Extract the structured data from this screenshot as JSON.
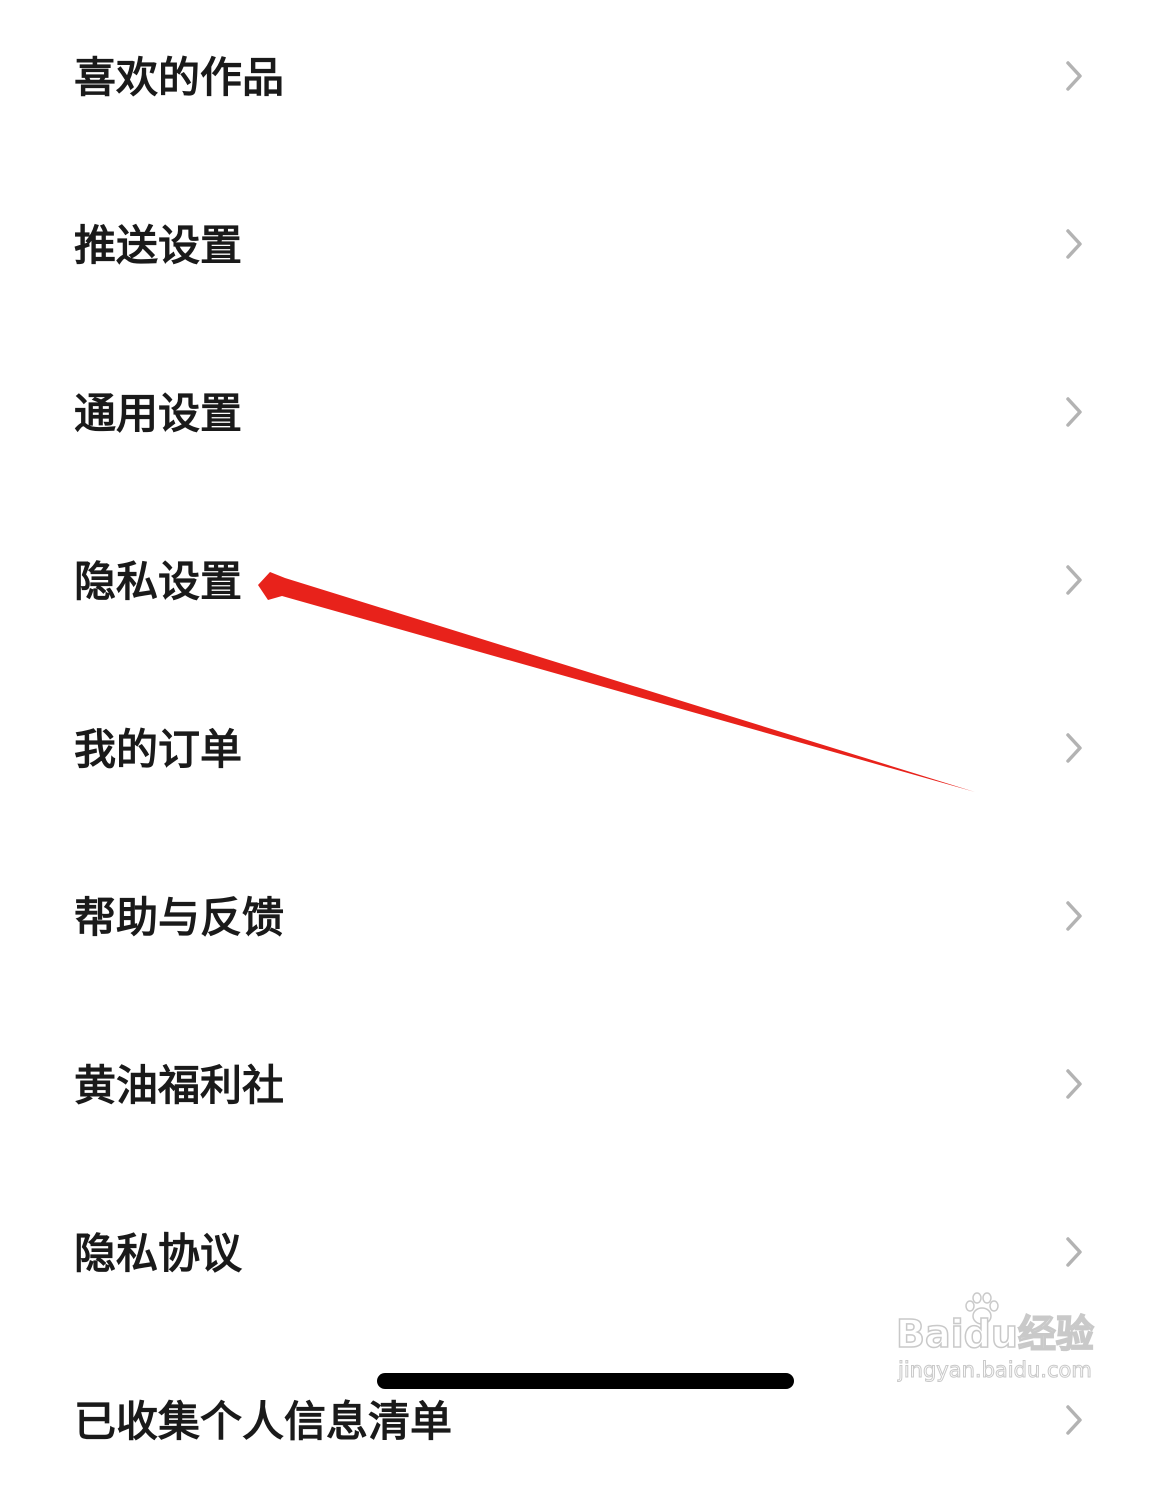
{
  "settings": {
    "items": [
      {
        "label": "喜欢的作品",
        "icon": "chevron-right-icon"
      },
      {
        "label": "推送设置",
        "icon": "chevron-right-icon"
      },
      {
        "label": "通用设置",
        "icon": "chevron-right-icon"
      },
      {
        "label": "隐私设置",
        "icon": "chevron-right-icon"
      },
      {
        "label": "我的订单",
        "icon": "chevron-right-icon"
      },
      {
        "label": "帮助与反馈",
        "icon": "chevron-right-icon"
      },
      {
        "label": "黄油福利社",
        "icon": "chevron-right-icon"
      },
      {
        "label": "隐私协议",
        "icon": "chevron-right-icon"
      },
      {
        "label": "已收集个人信息清单",
        "icon": "chevron-right-icon"
      }
    ]
  },
  "annotation": {
    "type": "arrow",
    "color": "#e8221b",
    "points_to": "隐私设置"
  },
  "watermark": {
    "brand": "Baidu经验",
    "url": "jingyan.baidu.com"
  },
  "colors": {
    "background": "#ffffff",
    "label": "#1a1a1a",
    "chevron": "#b3b3b3",
    "home_indicator": "#000000"
  }
}
